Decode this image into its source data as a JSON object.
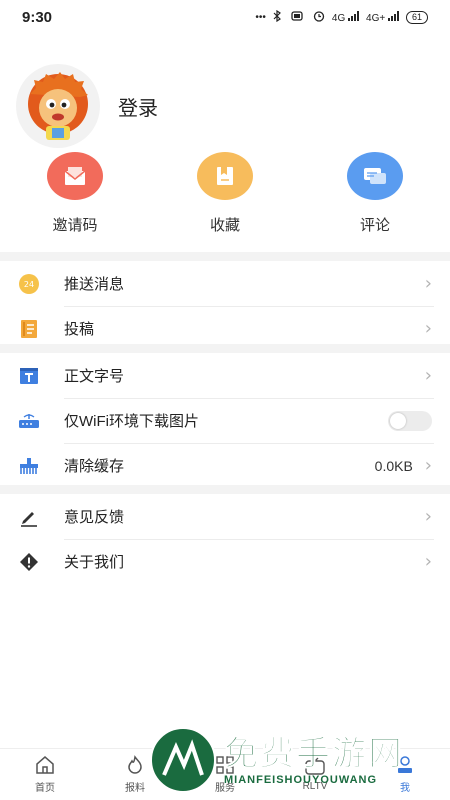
{
  "status": {
    "time": "9:30",
    "net_label_1": "4G",
    "net_label_2": "4G+",
    "battery": "61"
  },
  "profile": {
    "login_label": "登录"
  },
  "quick_actions": [
    {
      "label": "邀请码",
      "icon": "envelope-icon",
      "color": "#f26b5b"
    },
    {
      "label": "收藏",
      "icon": "bookmark-icon",
      "color": "#f7bc5c"
    },
    {
      "label": "评论",
      "icon": "chat-icon",
      "color": "#5a9cf0"
    }
  ],
  "menu": {
    "push": {
      "label": "推送消息",
      "badge": "24"
    },
    "contribute": {
      "label": "投稿"
    },
    "font_size": {
      "label": "正文字号"
    },
    "wifi_images": {
      "label": "仅WiFi环境下载图片",
      "enabled": false
    },
    "clear_cache": {
      "label": "清除缓存",
      "value": "0.0KB"
    },
    "feedback": {
      "label": "意见反馈"
    },
    "about": {
      "label": "关于我们"
    }
  },
  "chevron": "›",
  "tabs": [
    {
      "label": "首页"
    },
    {
      "label": "报料"
    },
    {
      "label": "服务"
    },
    {
      "label": "RLTV"
    },
    {
      "label": "我",
      "active": true
    }
  ],
  "watermark": {
    "title": "免费手游网",
    "subtitle": "MIANFEISHOUYOUWANG"
  }
}
